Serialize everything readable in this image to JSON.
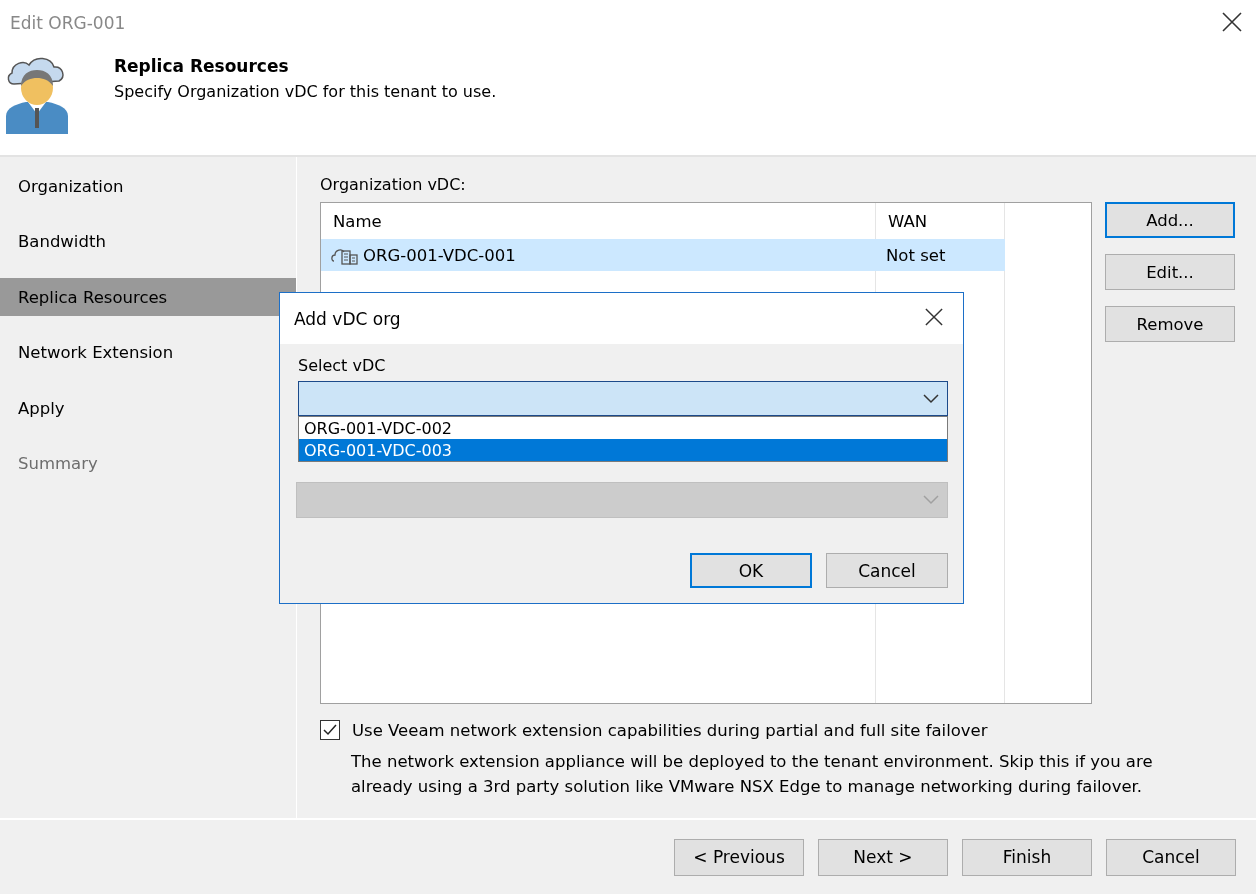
{
  "window": {
    "title": "Edit ORG-001"
  },
  "header": {
    "title": "Replica Resources",
    "subtitle": "Specify Organization vDC for this tenant to use."
  },
  "sidebar": {
    "items": [
      {
        "label": "Organization",
        "selected": false,
        "disabled": false
      },
      {
        "label": "Bandwidth",
        "selected": false,
        "disabled": false
      },
      {
        "label": "Replica Resources",
        "selected": true,
        "disabled": false
      },
      {
        "label": "Network Extension",
        "selected": false,
        "disabled": false
      },
      {
        "label": "Apply",
        "selected": false,
        "disabled": false
      },
      {
        "label": "Summary",
        "selected": false,
        "disabled": true
      }
    ]
  },
  "vdc": {
    "label": "Organization vDC:",
    "columns": [
      "Name",
      "WAN"
    ],
    "rows": [
      {
        "name": "ORG-001-VDC-001",
        "wan": "Not set",
        "selected": true
      }
    ],
    "buttons": [
      {
        "label": "Add...",
        "default": true
      },
      {
        "label": "Edit...",
        "default": false
      },
      {
        "label": "Remove",
        "default": false
      }
    ]
  },
  "network_extension": {
    "label": "Use Veeam network extension capabilities during partial and full site failover",
    "checked": true,
    "description": "The network extension appliance will be deployed to the tenant environment. Skip this if you are already using a 3rd party solution like VMware NSX Edge to manage networking during failover."
  },
  "footer": {
    "buttons": [
      "< Previous",
      "Next >",
      "Finish",
      "Cancel"
    ]
  },
  "dialog": {
    "title": "Add vDC org",
    "select_label": "Select vDC",
    "options": [
      {
        "label": "ORG-001-VDC-002",
        "selected": false
      },
      {
        "label": "ORG-001-VDC-003",
        "selected": true
      }
    ],
    "buttons": [
      {
        "label": "OK",
        "default": true
      },
      {
        "label": "Cancel",
        "default": false
      }
    ]
  }
}
